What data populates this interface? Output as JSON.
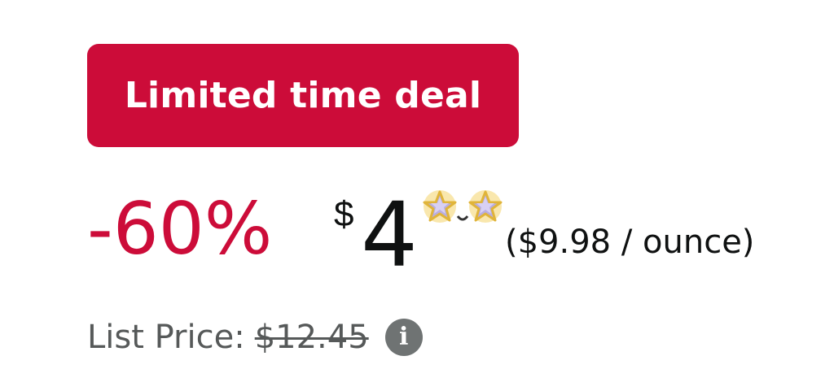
{
  "deal": {
    "badge_label": "Limited time deal",
    "badge_color": "#cc0c39"
  },
  "price": {
    "discount": "-60%",
    "currency_symbol": "$",
    "whole": "4",
    "per_unit": "($9.98 / ounce)",
    "discount_color": "#cc0c39",
    "fraction_obscured_by": "star-sticker-icon"
  },
  "list_price": {
    "label": "List Price:",
    "value": "$12.45",
    "info_icon": "info-icon",
    "info_glyph": "i"
  }
}
